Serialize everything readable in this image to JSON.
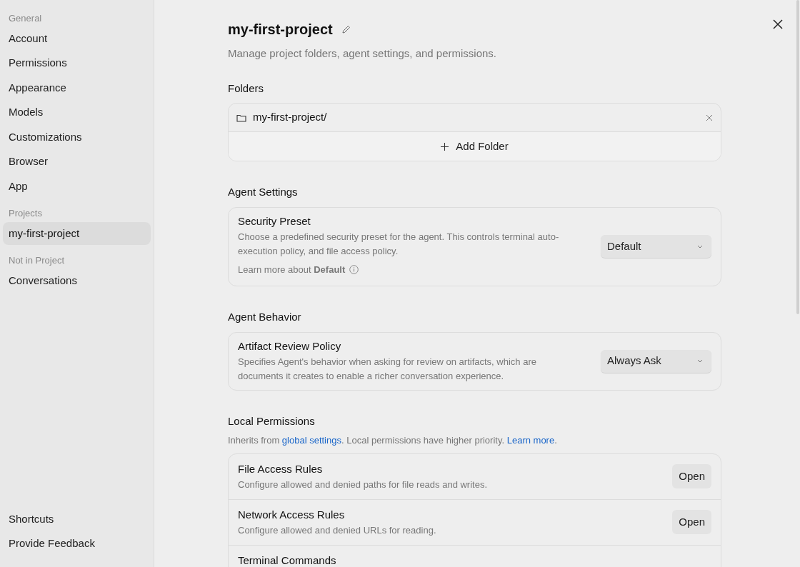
{
  "sidebar": {
    "sections": [
      {
        "label": "General",
        "items": [
          {
            "label": "Account",
            "selected": false
          },
          {
            "label": "Permissions",
            "selected": false
          },
          {
            "label": "Appearance",
            "selected": false
          },
          {
            "label": "Models",
            "selected": false
          },
          {
            "label": "Customizations",
            "selected": false
          },
          {
            "label": "Browser",
            "selected": false
          },
          {
            "label": "App",
            "selected": false
          }
        ]
      },
      {
        "label": "Projects",
        "items": [
          {
            "label": "my-first-project",
            "selected": true
          }
        ]
      },
      {
        "label": "Not in Project",
        "items": [
          {
            "label": "Conversations",
            "selected": false
          }
        ]
      }
    ],
    "footer_items": [
      {
        "label": "Shortcuts",
        "selected": false
      },
      {
        "label": "Provide Feedback",
        "selected": false
      }
    ]
  },
  "header": {
    "title": "my-first-project",
    "subtitle": "Manage project folders, agent settings, and permissions."
  },
  "folders": {
    "heading": "Folders",
    "items": [
      "my-first-project/"
    ],
    "add_label": "Add Folder"
  },
  "sections": [
    {
      "heading": "Agent Settings",
      "rows": [
        {
          "kind": "select",
          "title": "Security Preset",
          "description": "Choose a predefined security preset for the agent. This controls terminal auto-execution policy, and file access policy.",
          "value": "Default",
          "note": "Learn more about **Default**"
        }
      ]
    },
    {
      "heading": "Agent Behavior",
      "rows": [
        {
          "kind": "select",
          "title": "Artifact Review Policy",
          "description": "Specifies Agent's behavior when asking for review on artifacts, which are documents it creates to enable a richer conversation experience.",
          "value": "Always Ask"
        }
      ]
    },
    {
      "heading": "Local Permissions",
      "intro": [
        {
          "text": "Inherits from "
        },
        {
          "text": "global settings",
          "link": true
        },
        {
          "text": ". Local permissions have higher priority. "
        },
        {
          "text": "Learn more",
          "link": true
        },
        {
          "text": "."
        }
      ],
      "rows": [
        {
          "kind": "button",
          "title": "File Access Rules",
          "description": "Configure allowed and denied paths for file reads and writes.",
          "button": "Open"
        },
        {
          "kind": "button",
          "title": "Network Access Rules",
          "description": "Configure allowed and denied URLs for reading.",
          "button": "Open"
        },
        {
          "kind": "button",
          "title": "Terminal Commands"
        }
      ]
    }
  ]
}
